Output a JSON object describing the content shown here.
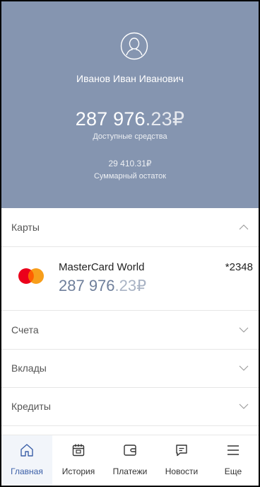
{
  "profile": {
    "name": "Иванов Иван Иванович",
    "balance_int": "287 976",
    "balance_frac": ".23",
    "currency": "₽",
    "balance_label": "Доступные средства",
    "total": "29 410.31₽",
    "total_label": "Суммарный остаток"
  },
  "sections": {
    "cards": "Карты",
    "accounts": "Счета",
    "deposits": "Вклады",
    "credits": "Кредиты"
  },
  "card": {
    "name": "MasterCard World",
    "number": "*2348",
    "balance_int": "287 976",
    "balance_frac": ".23",
    "currency": "₽"
  },
  "nav": {
    "items": [
      {
        "label": "Главная",
        "icon": "home-icon"
      },
      {
        "label": "История",
        "icon": "calendar-icon"
      },
      {
        "label": "Платежи",
        "icon": "wallet-icon"
      },
      {
        "label": "Новости",
        "icon": "chat-icon"
      },
      {
        "label": "Еще",
        "icon": "menu-icon"
      }
    ]
  },
  "colors": {
    "header_bg": "#8595b0",
    "accent": "#3b5fa8",
    "balance": "#6f7f9b"
  }
}
